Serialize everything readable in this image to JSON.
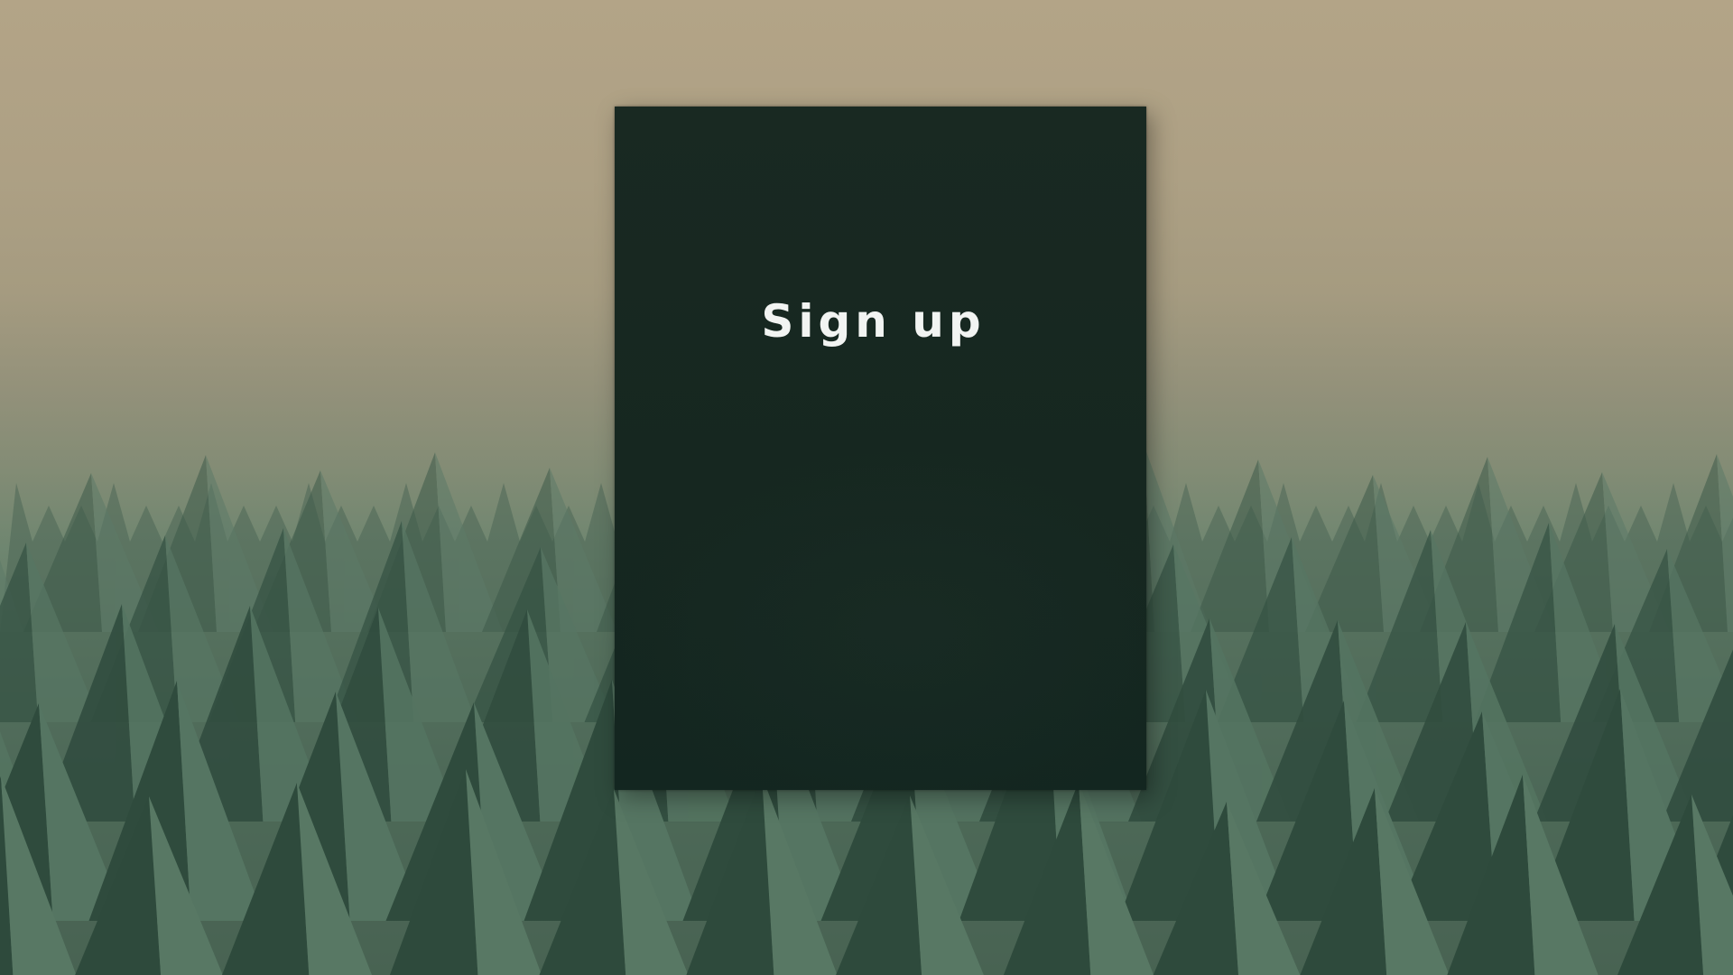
{
  "page": {
    "title": "Sign up"
  },
  "colors": {
    "sky_top": "#b3a487",
    "sky_mid": "#838c75",
    "ground": "#44604f",
    "panel": "#172821",
    "title_text": "#f2f4f2"
  },
  "background": {
    "icon": "pyramid-foam-pattern"
  }
}
